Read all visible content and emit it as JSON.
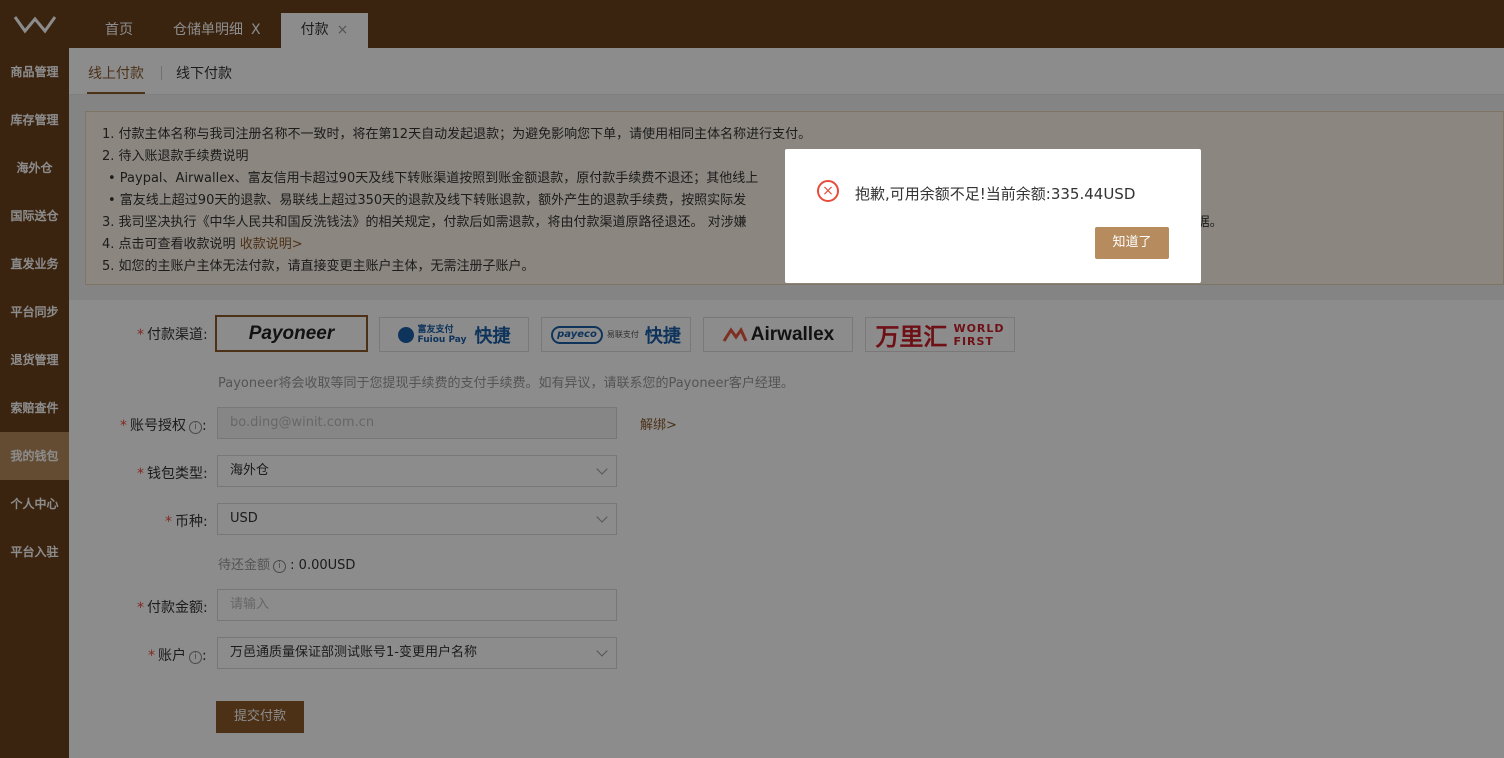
{
  "header": {
    "logo": "W",
    "tabs": [
      {
        "label": "首页",
        "closable": false,
        "active": false
      },
      {
        "label": "仓储单明细",
        "closable": true,
        "active": false
      },
      {
        "label": "付款",
        "closable": true,
        "active": true
      }
    ],
    "close_glyph": "X",
    "active_close_glyph": "×"
  },
  "sidebar": {
    "items": [
      {
        "label": "商品管理"
      },
      {
        "label": "库存管理"
      },
      {
        "label": "海外仓"
      },
      {
        "label": "国际送仓"
      },
      {
        "label": "直发业务"
      },
      {
        "label": "平台同步"
      },
      {
        "label": "退货管理"
      },
      {
        "label": "索赔查件"
      },
      {
        "label": "我的钱包",
        "active": true
      },
      {
        "label": "个人中心"
      },
      {
        "label": "平台入驻"
      }
    ]
  },
  "subtabs": {
    "online": "线上付款",
    "offline": "线下付款"
  },
  "notice": {
    "line1": "1. 付款主体名称与我司注册名称不一致时，将在第12天自动发起退款；为避免影响您下单，请使用相同主体名称进行支付。",
    "line2": "2. 待入账退款手续费说明",
    "bullet1": "• Paypal、Airwallex、富友信用卡超过90天及线下转账渠道按照到账金额退款，原付款手续费不退还；其他线上",
    "bullet2": "• 富友线上超过90天的退款、易联线上超过350天的退款及线下转账退款，额外产生的退款手续费，按照实际发",
    "line3": "3. 我司坚决执行《中华人民共和国反洗钱法》的相关规定，付款后如需退款，将由付款渠道原路径退还。 对涉嫌",
    "line3_tail": "关提供证据。",
    "line4": "4. 点击可查看收款说明",
    "line4_link": "收款说明>",
    "line5": "5. 如您的主账户主体无法付款，请直接变更主账户主体，无需注册子账户。"
  },
  "form": {
    "required_mark": "*",
    "info_glyph": "i",
    "channel_label": "付款渠道:",
    "channels": [
      {
        "name": "Payoneer",
        "selected": true
      },
      {
        "name": "富友支付 Fuiou Pay 快捷",
        "cn": "富友支付",
        "en": "Fuiou Pay",
        "quick": "快捷"
      },
      {
        "name": "payeco 易联支付 快捷",
        "brand": "payeco",
        "cn": "易联支付",
        "quick": "快捷"
      },
      {
        "name": "Airwallex"
      },
      {
        "name": "万里汇 WORLD FIRST",
        "cn": "万里汇",
        "en1": "WORLD",
        "en2": "FIRST"
      }
    ],
    "channel_hint": "Payoneer将会收取等同于您提现手续费的支付手续费。如有异议，请联系您的Payoneer客户经理。",
    "account_auth_label": "账号授权",
    "account_auth_value": "bo.ding@winit.com.cn",
    "unbind": "解绑>",
    "wallet_type_label": "钱包类型:",
    "wallet_type_value": "海外仓",
    "currency_label": "币种:",
    "currency_value": "USD",
    "pending_label": "待还金额",
    "pending_value": ": 0.00USD",
    "amount_label": "付款金额:",
    "amount_placeholder": "请输入",
    "account_label": "账户",
    "account_value": "万邑通质量保证部测试账号1-变更用户名称",
    "submit": "提交付款"
  },
  "modal": {
    "icon": "error-icon",
    "icon_glyph": "×",
    "message": "抱歉,可用余额不足!当前余额:335.44USD",
    "button": "知道了"
  }
}
